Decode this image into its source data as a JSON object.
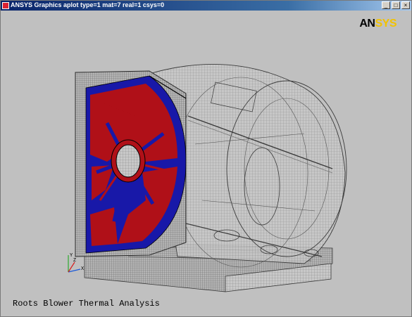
{
  "window": {
    "title": "ANSYS Graphics  aplot  type=1 mat=7 real=1 csys=0",
    "buttons": {
      "minimize": "_",
      "maximize": "□",
      "close": "×"
    }
  },
  "logo": {
    "part1": "AN",
    "part2": "SYS"
  },
  "caption": "Roots Blower Thermal Analysis",
  "triad": {
    "x_label": "X",
    "y_label": "Y",
    "z_label": "Z"
  },
  "colors": {
    "background": "#c0c0c0",
    "mesh_red": "#b01018",
    "mesh_blue": "#1818a8",
    "wireframe": "#3a3a3a",
    "logo_accent": "#f2c300"
  },
  "icons": {
    "app": "ansys-app-icon",
    "triad": "axis-triad-icon"
  }
}
